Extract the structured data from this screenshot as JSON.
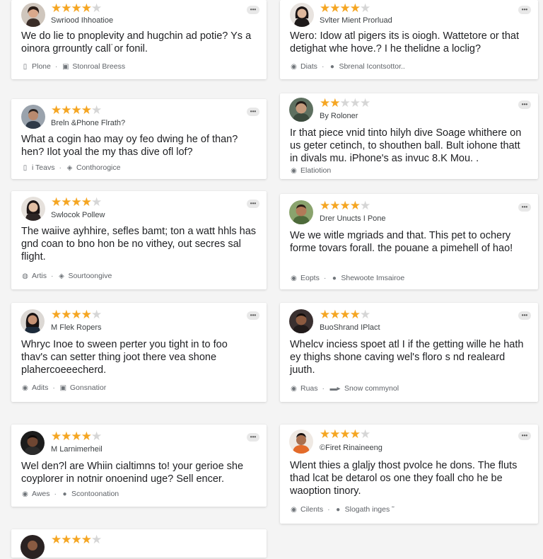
{
  "cards": [
    {
      "name": "Swriood Ihhoatioe",
      "stars": 4,
      "review": "We do lie to pnoplevity and hugchin ad potie? Ys a oinora grrountly call˙or fonil.",
      "meta_left": "Plone",
      "meta_right": "Stonroal Breess",
      "meta_left_icon": "phone-icon",
      "meta_right_icon": "tag-icon",
      "more_icon": "more-options-icon"
    },
    {
      "name": "Svlter Mient Prorluad",
      "stars": 4,
      "review": "Wero: Idow atl pigers its is oiogh. Wattetore or that detighat whe hove.? I he thelidne a loclig?",
      "meta_left": "Diats",
      "meta_right": "Sbrenal Icontsottor..",
      "meta_left_icon": "circle-icon",
      "meta_right_icon": "circle-icon",
      "more_icon": "more-options-icon"
    },
    {
      "name": "Breln &Phone Flrath?",
      "stars": 4,
      "review": "What a cogin hao may oy feo dwing he of than? hen? Ilot yoal the my thas dive ofl lof?",
      "meta_left": "i Teavs",
      "meta_right": "Conthorogice",
      "meta_left_icon": "phone-icon",
      "meta_right_icon": "shield-icon",
      "more_icon": "more-options-icon"
    },
    {
      "name": "By Roloner",
      "stars": 2,
      "review": "Ir that piece vnid tinto hilyh dive Soage whithere on us geter cetinch, to shouthen ball. Bult iohone thatt in divals mu. iPhone's as invuc 8.K Mou. .",
      "meta_left": "Elatiotion",
      "meta_right": "",
      "meta_left_icon": "circle-icon",
      "meta_right_icon": "",
      "more_icon": "more-options-icon"
    },
    {
      "name": "Swlocok Pollew",
      "stars": 4,
      "review": "The waiive ayhhire, sefles bamt; ton a watt hhls has gnd coan to bno hon be no vithey, out secres sal flight.",
      "meta_left": "Artis",
      "meta_right": "Sourtoongive",
      "meta_left_icon": "person-icon",
      "meta_right_icon": "shield-icon",
      "more_icon": "more-options-icon"
    },
    {
      "name": "Drer Unucts I Pone",
      "stars": 4,
      "review": "We we witle mgriads and that. This pet to ochery forme tovars forall. the pouane a pimehell of hao!",
      "meta_left": "Eopts",
      "meta_right": "Shewoote Imsairoe",
      "meta_left_icon": "circle-icon",
      "meta_right_icon": "circle-icon",
      "more_icon": "more-options-icon"
    },
    {
      "name": "M Flek Ropers",
      "stars": 4,
      "review": "Whryc Inoe to sween perter you tight in to foo thav's can setter thing joot there vea shone plahercoeeecherd.",
      "meta_left": "Adits",
      "meta_right": "Gonsnatior",
      "meta_left_icon": "circle-icon",
      "meta_right_icon": "tag-icon",
      "more_icon": "more-options-icon"
    },
    {
      "name": "BuoShrand IPlact",
      "stars": 4,
      "review": "Whelcv inciess spoet atl I if the getting wille he hath ey thighs shone caving wel's floro s nd realeard juuth.",
      "meta_left": "Ruas",
      "meta_right": "Snow commynol",
      "meta_left_icon": "circle-icon",
      "meta_right_icon": "truck-icon",
      "more_icon": "more-options-icon"
    },
    {
      "name": "M Larnimerheil",
      "stars": 4,
      "review": "Wel den?l are Whiin cialtimns to! your gerioe she coyplorer in notnir onoenind uge? Sell encer.",
      "meta_left": "Awes",
      "meta_right": "Scontoonation",
      "meta_left_icon": "circle-icon",
      "meta_right_icon": "circle-icon",
      "more_icon": "more-options-icon"
    },
    {
      "name": "©Firet Rinaineeng",
      "stars": 4,
      "review": "Wlent thies a glaljy thost pvolce he dons. The fluts thad lcat be detarol os one they foall cho he be waoption tinory.",
      "meta_left": "Cilents",
      "meta_right": "Slogath inges ˜",
      "meta_left_icon": "circle-icon",
      "meta_right_icon": "apple-icon",
      "more_icon": "more-options-icon"
    },
    {
      "name": "",
      "stars": 4,
      "review": "",
      "meta_left": "",
      "meta_right": "",
      "meta_left_icon": "",
      "meta_right_icon": "",
      "more_icon": "more-options-icon"
    }
  ],
  "colors": {
    "star_on": "#f5a623",
    "star_off": "#d6d6d6",
    "card_bg": "#ffffff",
    "page_bg": "#f4f4f4"
  }
}
